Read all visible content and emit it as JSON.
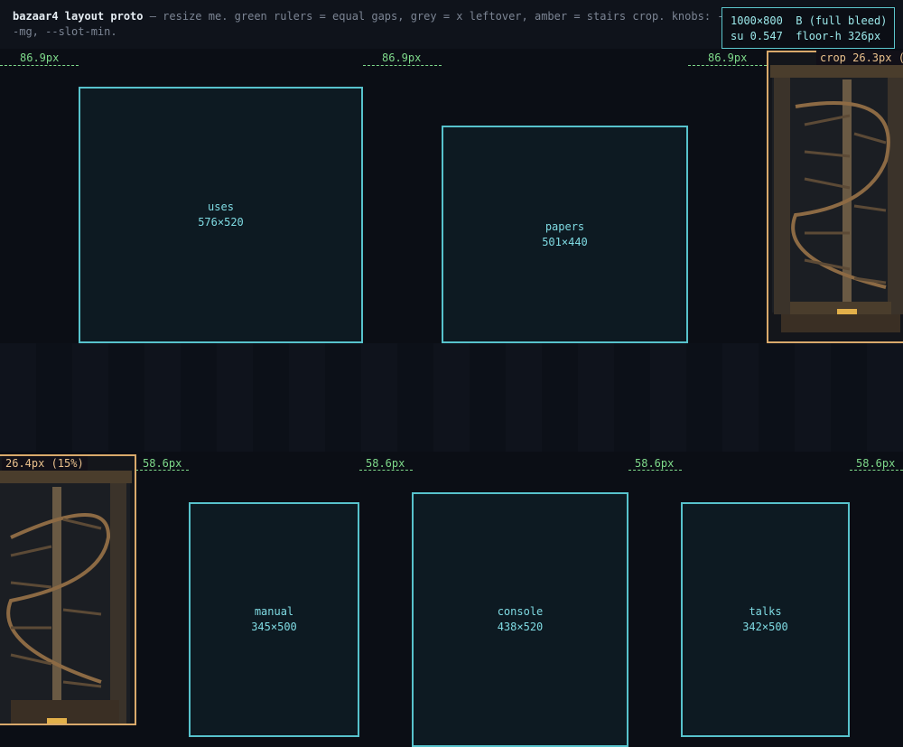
{
  "header": {
    "title": "bazaar4 layout proto",
    "description": " — resize me. green rulers = equal gaps, grey = x leftover, amber = stairs crop. knobs: --mg, --slot-min."
  },
  "info": {
    "line1": "1000×800  B (full bleed)",
    "line2": "su 0.547  floor-h 326px"
  },
  "top_row": {
    "gaps": [
      "86.9px",
      "86.9px",
      "86.9px"
    ],
    "crop_label": "crop 26.3px (",
    "slots": [
      {
        "name": "uses",
        "size": "576×520"
      },
      {
        "name": "papers",
        "size": "501×440"
      }
    ]
  },
  "bottom_row": {
    "gaps": [
      "58.6px",
      "58.6px",
      "58.6px",
      "58.6px"
    ],
    "crop_label": "26.4px (15%)",
    "slots": [
      {
        "name": "manual",
        "size": "345×500"
      },
      {
        "name": "console",
        "size": "438×520"
      },
      {
        "name": "talks",
        "size": "342×500"
      }
    ]
  },
  "colors": {
    "gap_ruler": "#7ed98a",
    "slot_border": "#57c2cc",
    "stairs_crop": "#d9a96b",
    "background": "#0b0e15"
  }
}
